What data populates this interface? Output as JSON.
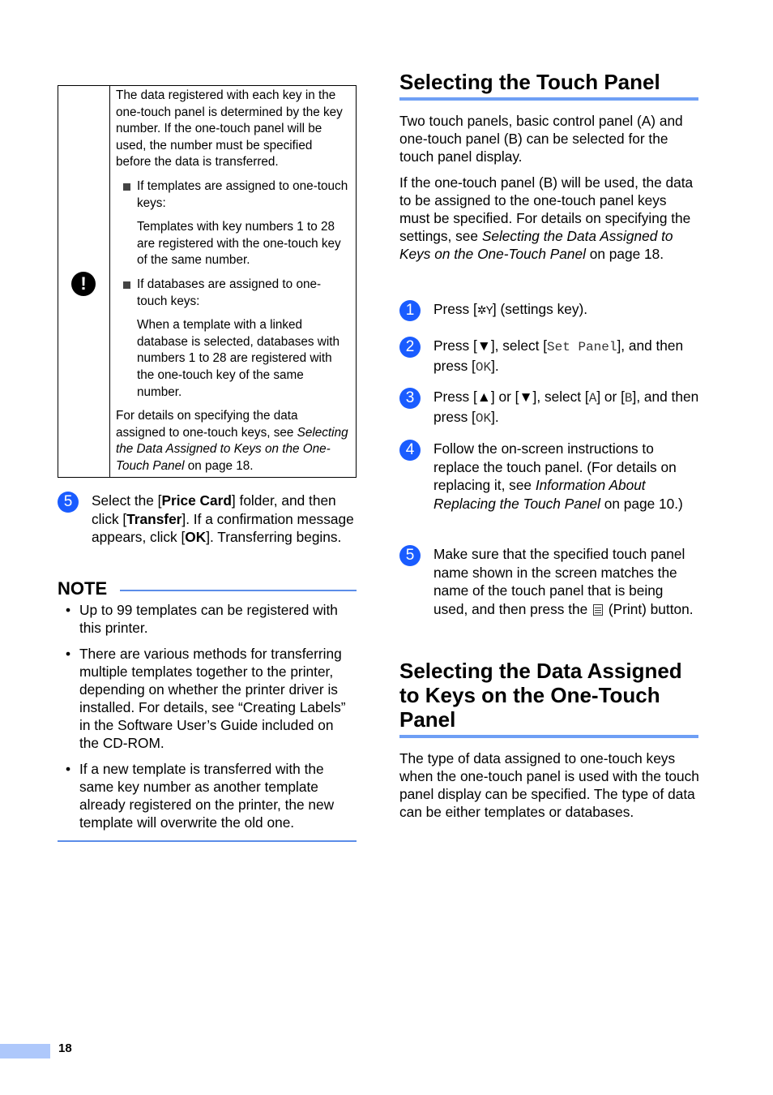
{
  "important_box": {
    "icon": "exclamation-icon",
    "intro": "The data registered with each key in the one-touch panel is determined by the key number. If the one-touch panel will be used, the number must be specified before the data is transferred.",
    "bullets": [
      {
        "label": "If templates are assigned to one-touch keys:",
        "detail": "Templates with key numbers 1 to 28 are registered with the one-touch key of the same number."
      },
      {
        "label": "If databases are assigned to one-touch keys:",
        "detail": "When a template with a linked database is selected, databases with numbers 1 to 28 are registered with the one-touch key of the same number."
      }
    ],
    "footer_prefix": "For details on specifying the data assigned to one-touch keys, see ",
    "footer_link": "Selecting the Data Assigned to Keys on the One-Touch Panel",
    "footer_suffix": " on page 18."
  },
  "left_step": {
    "number": "5",
    "t1": "Select the [",
    "b1": "Price Card",
    "t2": "] folder, and then click [",
    "b2": "Transfer",
    "t3": "]. If a confirmation message appears, click [",
    "b3": "OK",
    "t4": "]. Transferring begins."
  },
  "note": {
    "title": "NOTE",
    "items": [
      "Up to 99 templates can be registered with this printer.",
      "There are various methods for transferring multiple templates together to the printer, depending on whether the printer driver is installed. For details, see “Creating Labels” in the Software User’s Guide included on the CD-ROM.",
      "If a new template is transferred with the same key number as another template already registered on the printer, the new template will overwrite the old one."
    ]
  },
  "section1": {
    "title": "Selecting the Touch Panel",
    "para1": "Two touch panels, basic control panel (A) and one-touch panel (B) can be selected for the touch panel display.",
    "para2_prefix": "If the one-touch panel (B) will be used, the data to be assigned to the one-touch panel keys must be specified. For details on specifying the settings, see ",
    "para2_link": "Selecting the Data Assigned to Keys on the One-Touch Panel",
    "para2_suffix": " on page 18.",
    "steps": {
      "s1": {
        "num": "1",
        "a": "Press [",
        "icon": "settings-key-icon",
        "b": "] (settings key)."
      },
      "s2": {
        "num": "2",
        "a": "Press [▼], select [",
        "m1": "Set Panel",
        "b": "], and then press [",
        "m2": "OK",
        "c": "]."
      },
      "s3": {
        "num": "3",
        "a": "Press [▲] or [▼], select [",
        "m1": "A",
        "b": "] or [",
        "m2": "B",
        "c": "], and then press [",
        "m3": "OK",
        "d": "]."
      },
      "s4": {
        "num": "4",
        "a": "Follow the on-screen instructions to replace the touch panel. (For details on replacing it, see ",
        "link": "Information About Replacing the Touch Panel",
        "b": " on page 10.)"
      },
      "s5": {
        "num": "5",
        "a": "Make sure that the specified touch panel name shown in the screen matches the name of the touch panel that is being used, and then press the ",
        "icon": "print-icon",
        "b": " (Print) button."
      }
    }
  },
  "section2": {
    "title": "Selecting the Data Assigned to Keys on the One-Touch Panel",
    "para": "The type of data assigned to one-touch keys when the one-touch panel is used with the touch panel display can be specified. The type of data can be either templates or databases."
  },
  "footer": {
    "page_number": "18"
  }
}
